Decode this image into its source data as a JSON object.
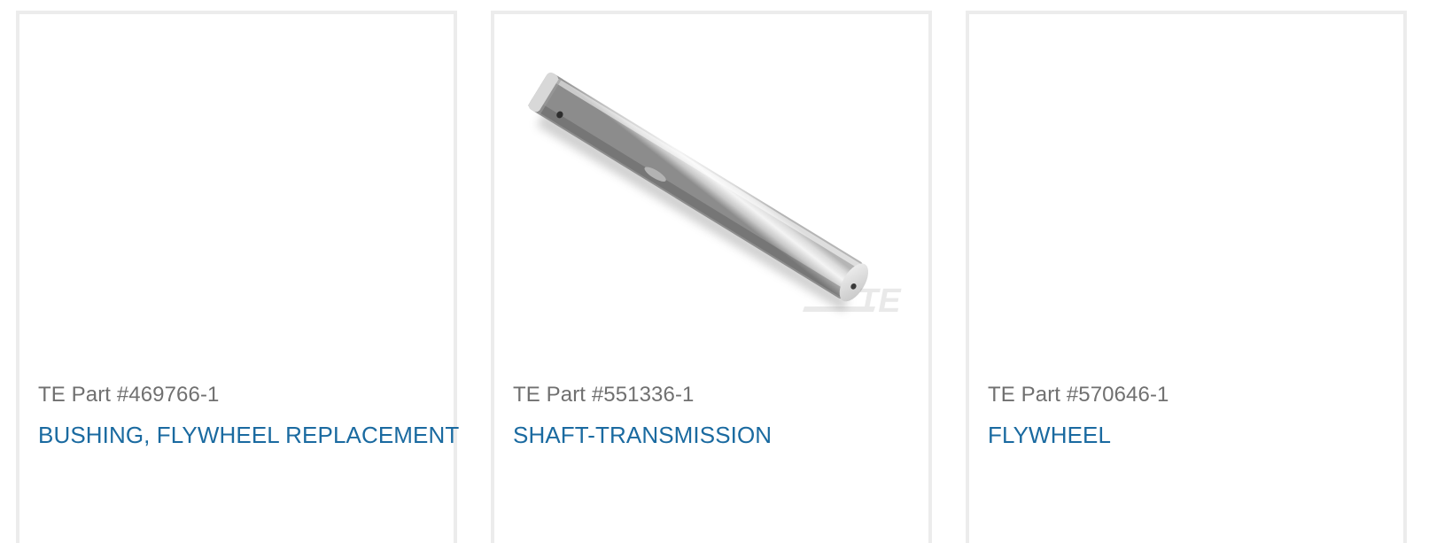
{
  "products": [
    {
      "part_number": "TE Part #469766-1",
      "title": "BUSHING, FLYWHEEL REPLACEMENT",
      "has_image": false
    },
    {
      "part_number": "TE Part #551336-1",
      "title": "SHAFT-TRANSMISSION",
      "has_image": true,
      "image_subject": "shaft-image",
      "watermark": "TE"
    },
    {
      "part_number": "TE Part #570646-1",
      "title": "FLYWHEEL",
      "has_image": false
    }
  ],
  "colors": {
    "card_border": "#ececec",
    "part_number_text": "#707070",
    "title_link": "#1a6aa0"
  }
}
